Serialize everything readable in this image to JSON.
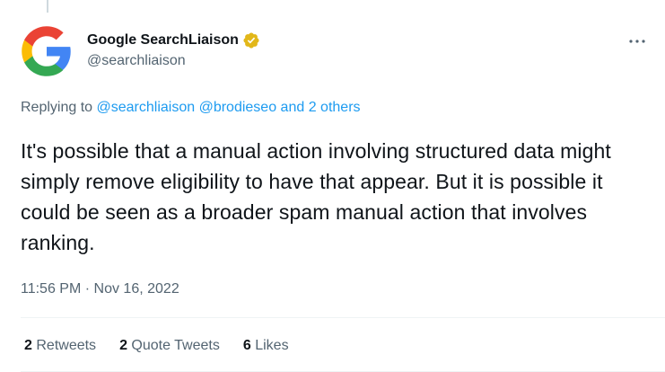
{
  "author": {
    "display_name": "Google SearchLiaison",
    "handle": "@searchliaison",
    "avatar_icon": "google-g-logo",
    "verified_icon": "verified-badge-icon",
    "verified_color": "#e2b719"
  },
  "more_icon": "more-icon",
  "replying": {
    "prefix": "Replying to",
    "mention_1": "@searchliaison",
    "mention_2": "@brodieseo",
    "and_text": "and",
    "others": "2 others"
  },
  "tweet": {
    "text": "It's possible that a manual action involving structured data might simply remove eligibility to have that appear. But it is possible it could be seen as a broader spam manual action that involves ranking."
  },
  "meta": {
    "time": "11:56 PM",
    "separator": "·",
    "date": "Nov 16, 2022"
  },
  "stats": {
    "retweets_count": "2",
    "retweets_label": "Retweets",
    "quotes_count": "2",
    "quotes_label": "Quote Tweets",
    "likes_count": "6",
    "likes_label": "Likes"
  },
  "colors": {
    "link": "#1d9bf0",
    "secondary_text": "#536471",
    "primary_text": "#0f1419",
    "google_blue": "#4285f4",
    "google_red": "#ea4335",
    "google_yellow": "#fbbc05",
    "google_green": "#34a853"
  }
}
